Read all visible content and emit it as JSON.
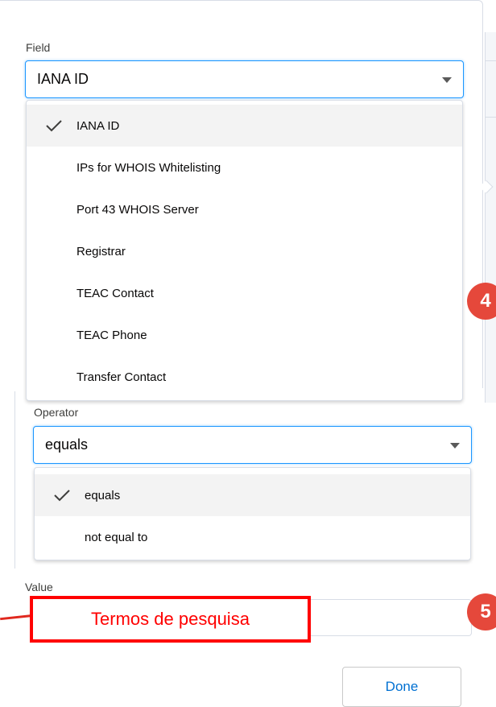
{
  "field": {
    "label": "Field",
    "selected_value": "IANA ID",
    "options": [
      {
        "label": "IANA ID",
        "selected": true
      },
      {
        "label": "IPs for WHOIS Whitelisting",
        "selected": false
      },
      {
        "label": "Port 43 WHOIS Server",
        "selected": false
      },
      {
        "label": "Registrar",
        "selected": false
      },
      {
        "label": "TEAC Contact",
        "selected": false
      },
      {
        "label": "TEAC Phone",
        "selected": false
      },
      {
        "label": "Transfer Contact",
        "selected": false
      }
    ]
  },
  "operator": {
    "label": "Operator",
    "selected_value": "equals",
    "options": [
      {
        "label": "equals",
        "selected": true
      },
      {
        "label": "not equal to",
        "selected": false
      }
    ]
  },
  "value": {
    "label": "Value",
    "annotation_text": "Termos de pesquisa"
  },
  "badges": {
    "step_4": "4",
    "step_5": "5"
  },
  "actions": {
    "done_label": "Done"
  },
  "colors": {
    "accent": "#1b96ff",
    "link_blue": "#0070d2",
    "badge_red": "#e5483b",
    "annotation_red": "#ff0000",
    "selected_row": "#f3f3f3"
  },
  "icons": {
    "check": "check-icon",
    "caret": "caret-down-icon"
  }
}
